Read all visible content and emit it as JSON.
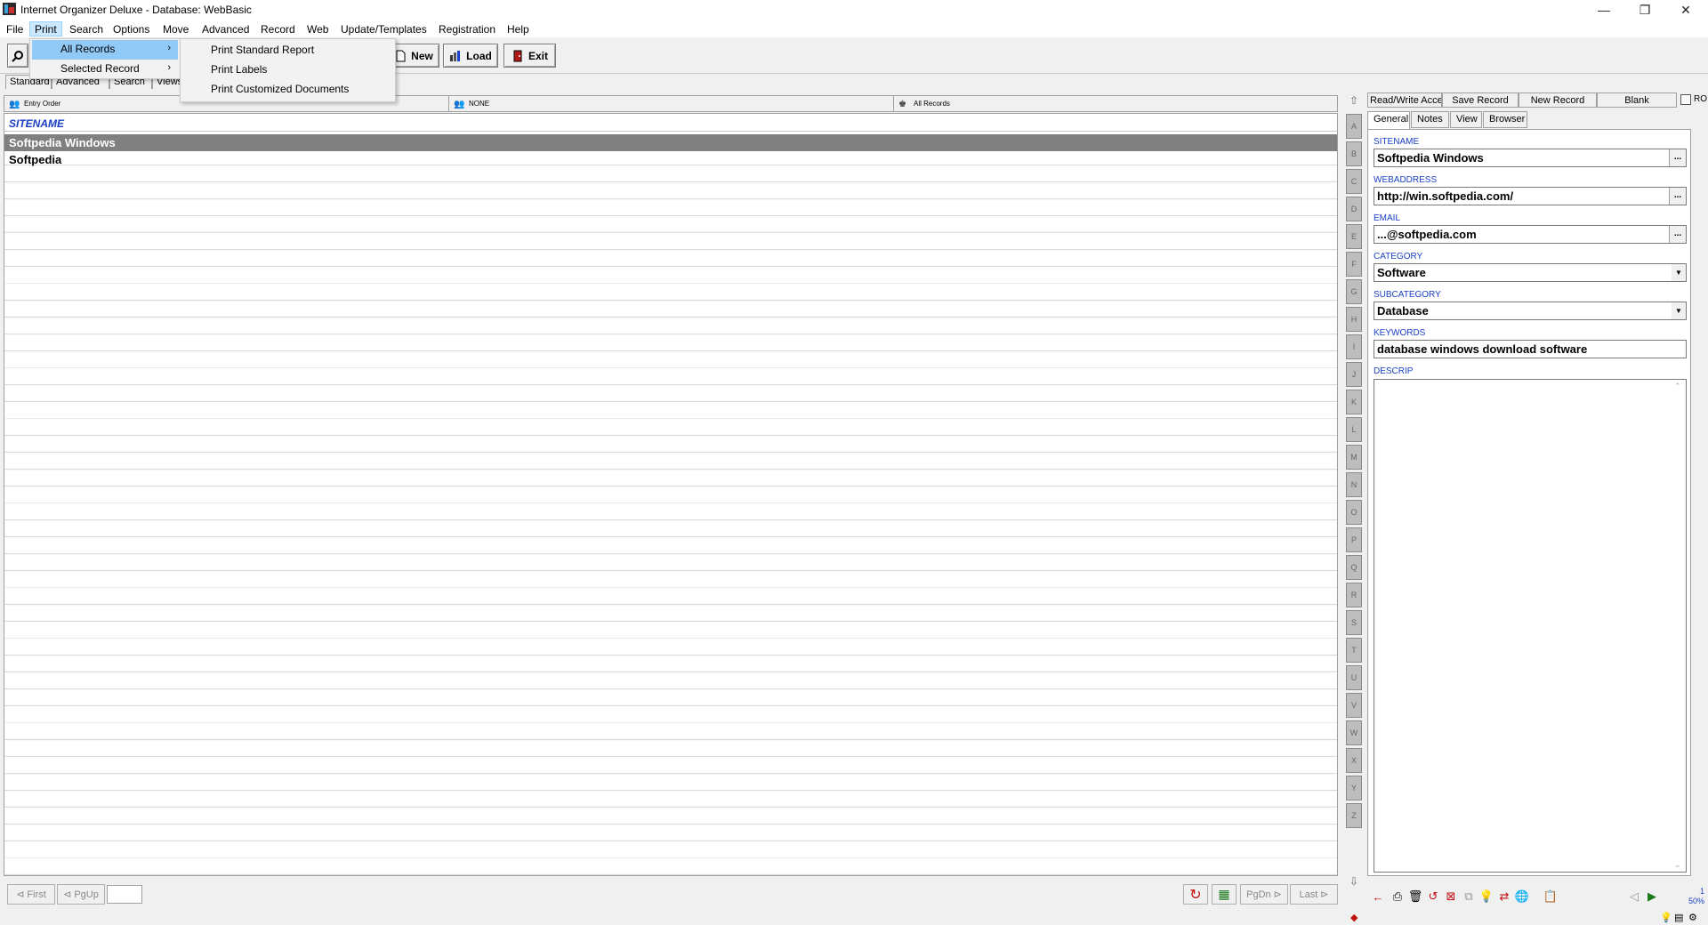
{
  "window": {
    "title": "Internet Organizer Deluxe - Database: WebBasic",
    "minimize": "—",
    "maximize": "❐",
    "close": "✕"
  },
  "menubar": [
    "File",
    "Print",
    "Search",
    "Options",
    "Move",
    "Advanced",
    "Record",
    "Web",
    "Update/Templates",
    "Registration",
    "Help"
  ],
  "print_menu": {
    "items": [
      {
        "label": "All Records",
        "arrow": "›"
      },
      {
        "label": "Selected Record",
        "arrow": "›"
      }
    ],
    "submenu": [
      "Print Standard Report",
      "Print Labels",
      "Print Customized Documents"
    ]
  },
  "toolbar": {
    "new_label": "New",
    "load_label": "Load",
    "exit_label": "Exit"
  },
  "subtabs": [
    "Standard",
    "Advanced",
    "Search",
    "Views"
  ],
  "sortbar": {
    "order": "Entry Order",
    "filter": "NONE",
    "scope": "All Records"
  },
  "grid": {
    "header": "SITENAME",
    "rows": [
      "Softpedia Windows",
      "Softpedia"
    ]
  },
  "alphabet": [
    "A",
    "B",
    "C",
    "D",
    "E",
    "F",
    "G",
    "H",
    "I",
    "J",
    "K",
    "L",
    "M",
    "N",
    "O",
    "P",
    "Q",
    "R",
    "S",
    "T",
    "U",
    "V",
    "W",
    "X",
    "Y",
    "Z"
  ],
  "navigation": {
    "first": "First",
    "pgup": "PgUp",
    "pgdn": "PgDn",
    "last": "Last"
  },
  "record_panel": {
    "access": "Read/Write Access",
    "save": "Save Record",
    "new": "New Record",
    "blank": "Blank",
    "ro": "RO",
    "tabs": [
      "General",
      "Notes",
      "View",
      "Browser"
    ],
    "fields": {
      "sitename_label": "SITENAME",
      "sitename": "Softpedia Windows",
      "webaddress_label": "WEBADDRESS",
      "webaddress": "http://win.softpedia.com/",
      "email_label": "EMAIL",
      "email": "...@softpedia.com",
      "category_label": "CATEGORY",
      "category": "Software",
      "subcategory_label": "SUBCATEGORY",
      "subcategory": "Database",
      "keywords_label": "KEYWORDS",
      "keywords": "database windows download software",
      "descrip_label": "DESCRIP"
    },
    "ellipsis": "...",
    "zoom": "50%",
    "zoom_top": "1"
  },
  "colors": {
    "accent_blue": "#1a3fc8",
    "selected_row": "#808080",
    "menu_highlight": "#91c9f7"
  }
}
